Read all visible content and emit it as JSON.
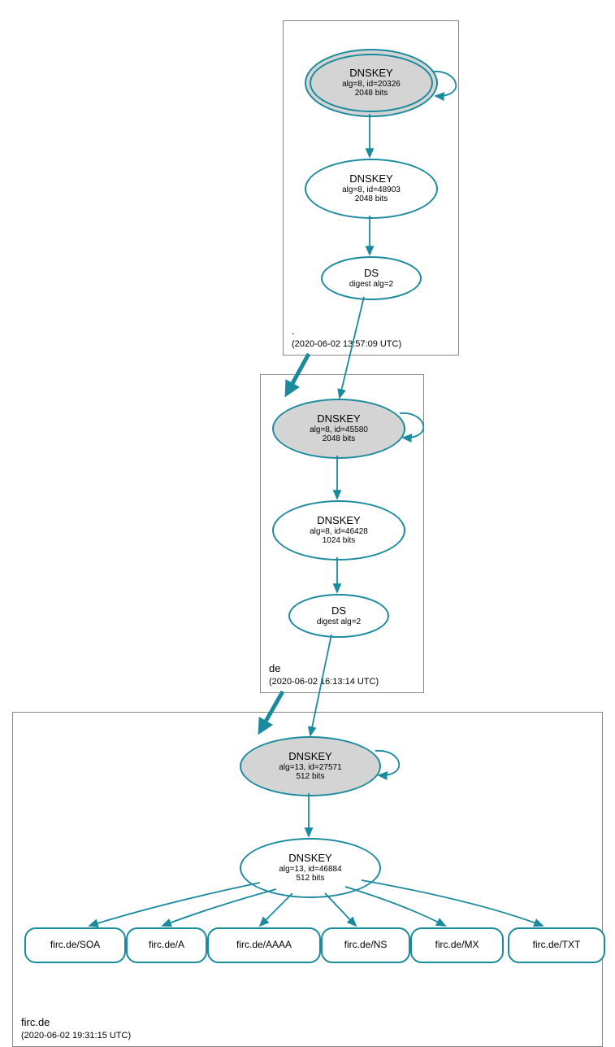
{
  "zones": {
    "root": {
      "name": ".",
      "ts": "(2020-06-02 13:57:09 UTC)"
    },
    "tld": {
      "name": "de",
      "ts": "(2020-06-02 16:13:14 UTC)"
    },
    "leaf": {
      "name": "firc.de",
      "ts": "(2020-06-02 19:31:15 UTC)"
    }
  },
  "nodes": {
    "root_ksk": {
      "title": "DNSKEY",
      "line2": "alg=8, id=20326",
      "line3": "2048 bits"
    },
    "root_zsk": {
      "title": "DNSKEY",
      "line2": "alg=8, id=48903",
      "line3": "2048 bits"
    },
    "root_ds": {
      "title": "DS",
      "line2": "digest alg=2"
    },
    "tld_ksk": {
      "title": "DNSKEY",
      "line2": "alg=8, id=45580",
      "line3": "2048 bits"
    },
    "tld_zsk": {
      "title": "DNSKEY",
      "line2": "alg=8, id=46428",
      "line3": "1024 bits"
    },
    "tld_ds": {
      "title": "DS",
      "line2": "digest alg=2"
    },
    "leaf_ksk": {
      "title": "DNSKEY",
      "line2": "alg=13, id=27571",
      "line3": "512 bits"
    },
    "leaf_zsk": {
      "title": "DNSKEY",
      "line2": "alg=13, id=46884",
      "line3": "512 bits"
    }
  },
  "rrsets": {
    "soa": "firc.de/SOA",
    "a": "firc.de/A",
    "aaaa": "firc.de/AAAA",
    "ns": "firc.de/NS",
    "mx": "firc.de/MX",
    "txt": "firc.de/TXT"
  }
}
